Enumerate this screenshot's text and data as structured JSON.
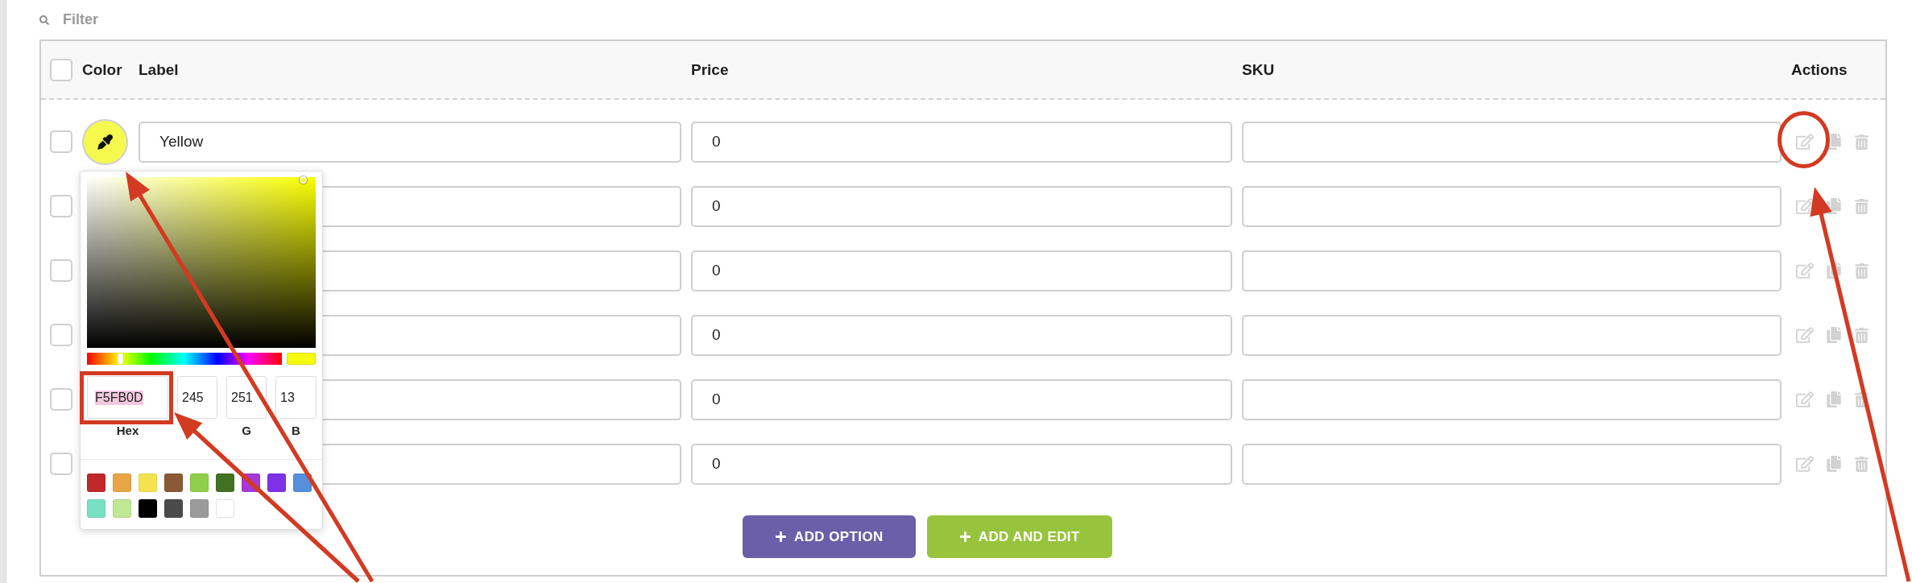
{
  "filter": {
    "placeholder": "Filter"
  },
  "table": {
    "select_all": {
      "checked": false
    },
    "columns": [
      "Color",
      "Label",
      "Price",
      "SKU",
      "Actions"
    ],
    "rows": [
      {
        "checked": false,
        "color": "#f5f94e",
        "label": "Yellow",
        "price": "0"
      },
      {
        "checked": false,
        "price": "0"
      },
      {
        "checked": false,
        "price": "0"
      },
      {
        "checked": false,
        "price": "0"
      },
      {
        "checked": false,
        "price": "0"
      },
      {
        "checked": false,
        "price": "0"
      }
    ]
  },
  "color_picker": {
    "hue": {
      "level": 0.17
    },
    "hex": {
      "label": "Hex",
      "value": "F5FB0D",
      "highlighted": true
    },
    "channels": [
      {
        "value": "245"
      },
      {
        "label": "G",
        "value": "251"
      },
      {
        "label": "B",
        "value": "13"
      }
    ],
    "presets": [
      {
        "color": "#c0282a"
      },
      {
        "color": "#e8a545"
      },
      {
        "color": "#f4e34f"
      },
      {
        "color": "#8b5a34"
      },
      {
        "color": "#8fcf4b"
      },
      {
        "color": "#437122"
      },
      {
        "color": "#a838d5"
      },
      {
        "color": "#7f31e8"
      },
      {
        "color": "#568fdc"
      },
      {
        "color": "#7ae0c3"
      },
      {
        "color": "#c1e894"
      },
      {
        "color": "#000000"
      },
      {
        "color": "#4a4a4a"
      },
      {
        "color": "#9b9b9b"
      },
      {
        "color": "#ffffff"
      }
    ]
  },
  "buttons": [
    {
      "kind": "primary",
      "label": "ADD OPTION"
    },
    {
      "kind": "secondary",
      "label": "ADD AND EDIT"
    }
  ],
  "annotations": [
    {
      "kind": "arrow"
    },
    {
      "kind": "arrow"
    },
    {
      "kind": "rectangle"
    },
    {
      "kind": "circle"
    },
    {
      "kind": "arrow"
    }
  ]
}
